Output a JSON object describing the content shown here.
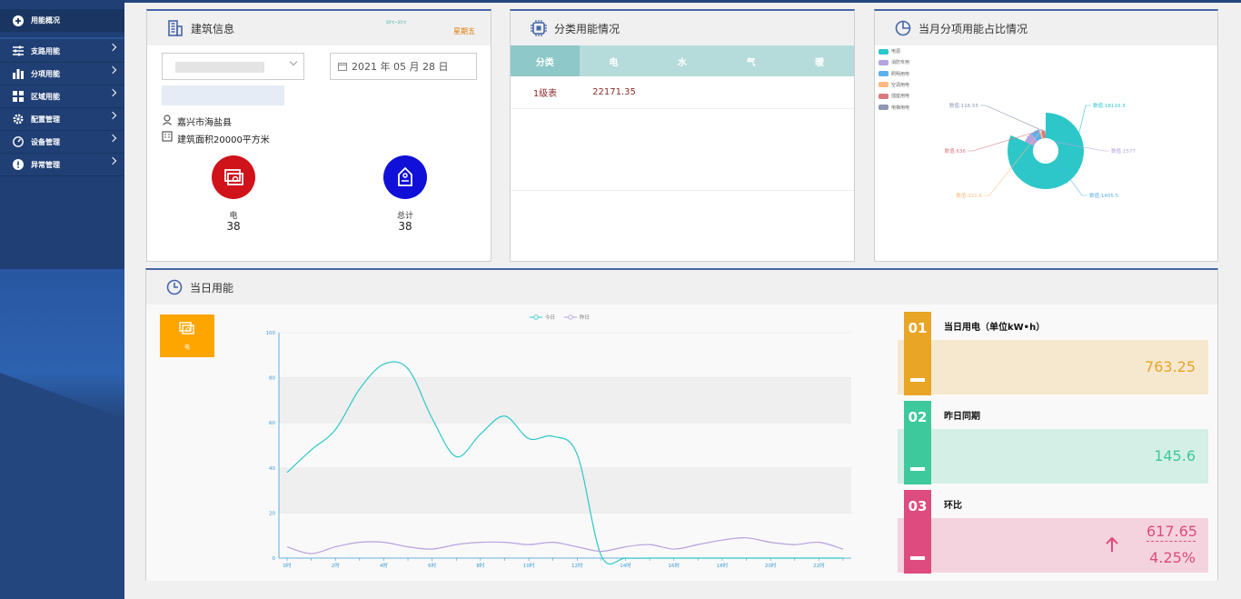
{
  "sidebar": {
    "items": [
      {
        "label": "用能概况",
        "icon": "plus-circle-icon"
      },
      {
        "label": "支路用能",
        "icon": "sliders-icon"
      },
      {
        "label": "分项用能",
        "icon": "bar-chart-icon"
      },
      {
        "label": "区域用能",
        "icon": "grid-icon"
      },
      {
        "label": "配置管理",
        "icon": "gear-icon"
      },
      {
        "label": "设备管理",
        "icon": "gauge-icon"
      },
      {
        "label": "异常管理",
        "icon": "alert-icon"
      }
    ]
  },
  "building": {
    "title": "建筑信息",
    "weekday": "星期五",
    "weather": "20℃~25℃",
    "date": "2021 年 05 月 28 日",
    "address": "嘉兴市海盐县",
    "area": "建筑面积20000平方米",
    "stats": [
      {
        "label": "电",
        "value": "38",
        "color": "#d0121b"
      },
      {
        "label": "总计",
        "value": "38",
        "color": "#1010d8"
      }
    ]
  },
  "category": {
    "title": "分类用能情况",
    "headers": [
      "分类",
      "电",
      "水",
      "气",
      "暖"
    ],
    "rows": [
      [
        "1级表",
        "22171.35",
        "",
        "",
        ""
      ]
    ]
  },
  "pie": {
    "title": "当月分项用能占比情况",
    "legend": [
      {
        "label": "电源",
        "color": "#2ec7c9"
      },
      {
        "label": "消防专用",
        "color": "#b6a2de"
      },
      {
        "label": "照明用电",
        "color": "#5ab1ef"
      },
      {
        "label": "空调用电",
        "color": "#ffb980"
      },
      {
        "label": "插座用电",
        "color": "#d87a80"
      },
      {
        "label": "电梯用电",
        "color": "#8d98b3"
      }
    ],
    "labels": [
      {
        "text": "数值:18110.3",
        "color": "#2ec7c9"
      },
      {
        "text": "数值:1577",
        "color": "#b6a2de"
      },
      {
        "text": "数值:1405.5",
        "color": "#5ab1ef"
      },
      {
        "text": "数值:321.6",
        "color": "#ffb980"
      },
      {
        "text": "数值:636",
        "color": "#d87a80"
      },
      {
        "text": "数值:116.55",
        "color": "#8d98b3"
      }
    ],
    "values": [
      18110.3,
      1577,
      1405.5,
      321.6,
      636,
      116.55
    ]
  },
  "daily": {
    "title": "当日用能",
    "tab_label": "电",
    "legend_today": "今日",
    "legend_yesterday": "昨日"
  },
  "chart_data": {
    "type": "line",
    "x": [
      "0时",
      "1时",
      "2时",
      "3时",
      "4时",
      "5时",
      "6时",
      "7时",
      "8时",
      "9时",
      "10时",
      "11时",
      "12时",
      "13时",
      "14时",
      "15时",
      "16时",
      "17时",
      "18时",
      "19时",
      "20时",
      "21时",
      "22时",
      "23时"
    ],
    "x_tick_labels": [
      "0时",
      "2时",
      "4时",
      "6时",
      "8时",
      "10时",
      "12时",
      "14时",
      "16时",
      "18时",
      "20时",
      "22时"
    ],
    "ylim": [
      0,
      100
    ],
    "y_ticks": [
      0,
      20,
      40,
      60,
      80,
      100
    ],
    "series": [
      {
        "name": "今日",
        "color": "#2ec7c9",
        "values": [
          38,
          48,
          57,
          75,
          86,
          84,
          62,
          45,
          55,
          63,
          53,
          54,
          46,
          1,
          0,
          0,
          0,
          0,
          0,
          0,
          0,
          0,
          0,
          0
        ]
      },
      {
        "name": "昨日",
        "color": "#b6a2de",
        "values": [
          5,
          2,
          5,
          7,
          7,
          5,
          4,
          6,
          7,
          7,
          6,
          7,
          5,
          3,
          5,
          6,
          4,
          6,
          8,
          9,
          7,
          6,
          7,
          4
        ]
      }
    ]
  },
  "kpis": [
    {
      "num": "01",
      "title": "当日用电（单位kW•h）",
      "value": "763.25",
      "color": "#e8a526",
      "bg": "#f6e8cf"
    },
    {
      "num": "02",
      "title": "昨日同期",
      "value": "145.6",
      "color": "#3dc99c",
      "bg": "#d3efe6"
    },
    {
      "num": "03",
      "title": "环比",
      "value": "617.65",
      "pct": "4.25%",
      "color": "#dd4b7f",
      "bg": "#f4d3de"
    }
  ]
}
